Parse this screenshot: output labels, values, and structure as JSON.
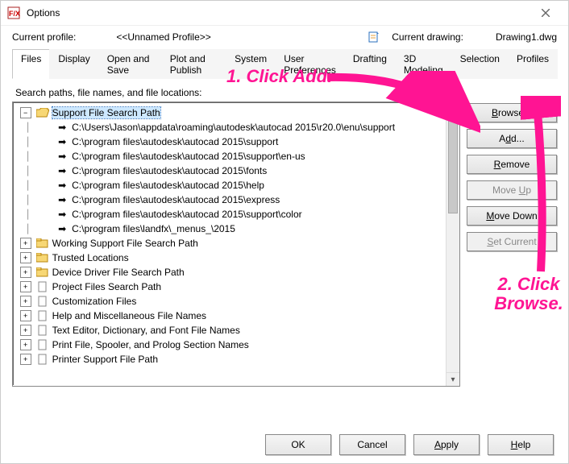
{
  "window": {
    "title": "Options"
  },
  "profile": {
    "current_label": "Current profile:",
    "current_value": "<<Unnamed Profile>>",
    "drawing_label": "Current drawing:",
    "drawing_value": "Drawing1.dwg"
  },
  "tabs": {
    "items": [
      "Files",
      "Display",
      "Open and Save",
      "Plot and Publish",
      "System",
      "User Preferences",
      "Drafting",
      "3D Modeling",
      "Selection",
      "Profiles"
    ],
    "active": 0
  },
  "prompt": "Search paths, file names, and file locations:",
  "tree": {
    "support": {
      "label": "Support File Search Path",
      "paths": [
        "C:\\Users\\Jason\\appdata\\roaming\\autodesk\\autocad 2015\\r20.0\\enu\\support",
        "C:\\program files\\autodesk\\autocad 2015\\support",
        "C:\\program files\\autodesk\\autocad 2015\\support\\en-us",
        "C:\\program files\\autodesk\\autocad 2015\\fonts",
        "C:\\program files\\autodesk\\autocad 2015\\help",
        "C:\\program files\\autodesk\\autocad 2015\\express",
        "C:\\program files\\autodesk\\autocad 2015\\support\\color",
        "C:\\program files\\landfx\\_menus_\\2015"
      ]
    },
    "others": [
      "Working Support File Search Path",
      "Trusted Locations",
      "Device Driver File Search Path",
      "Project Files Search Path",
      "Customization Files",
      "Help and Miscellaneous File Names",
      "Text Editor, Dictionary, and Font File Names",
      "Print File, Spooler, and Prolog Section Names",
      "Printer Support File Path"
    ]
  },
  "sidebtns": {
    "browse": "Browse...",
    "add": "Add...",
    "remove": "Remove",
    "moveup": "Move Up",
    "movedown": "Move Down",
    "setcurrent": "Set Current"
  },
  "bottom": {
    "ok": "OK",
    "cancel": "Cancel",
    "apply": "Apply",
    "help": "Help"
  },
  "annotations": {
    "a1": "1. Click Add.",
    "a2": "2. Click Browse."
  },
  "colors": {
    "accent": "#ff1493"
  }
}
